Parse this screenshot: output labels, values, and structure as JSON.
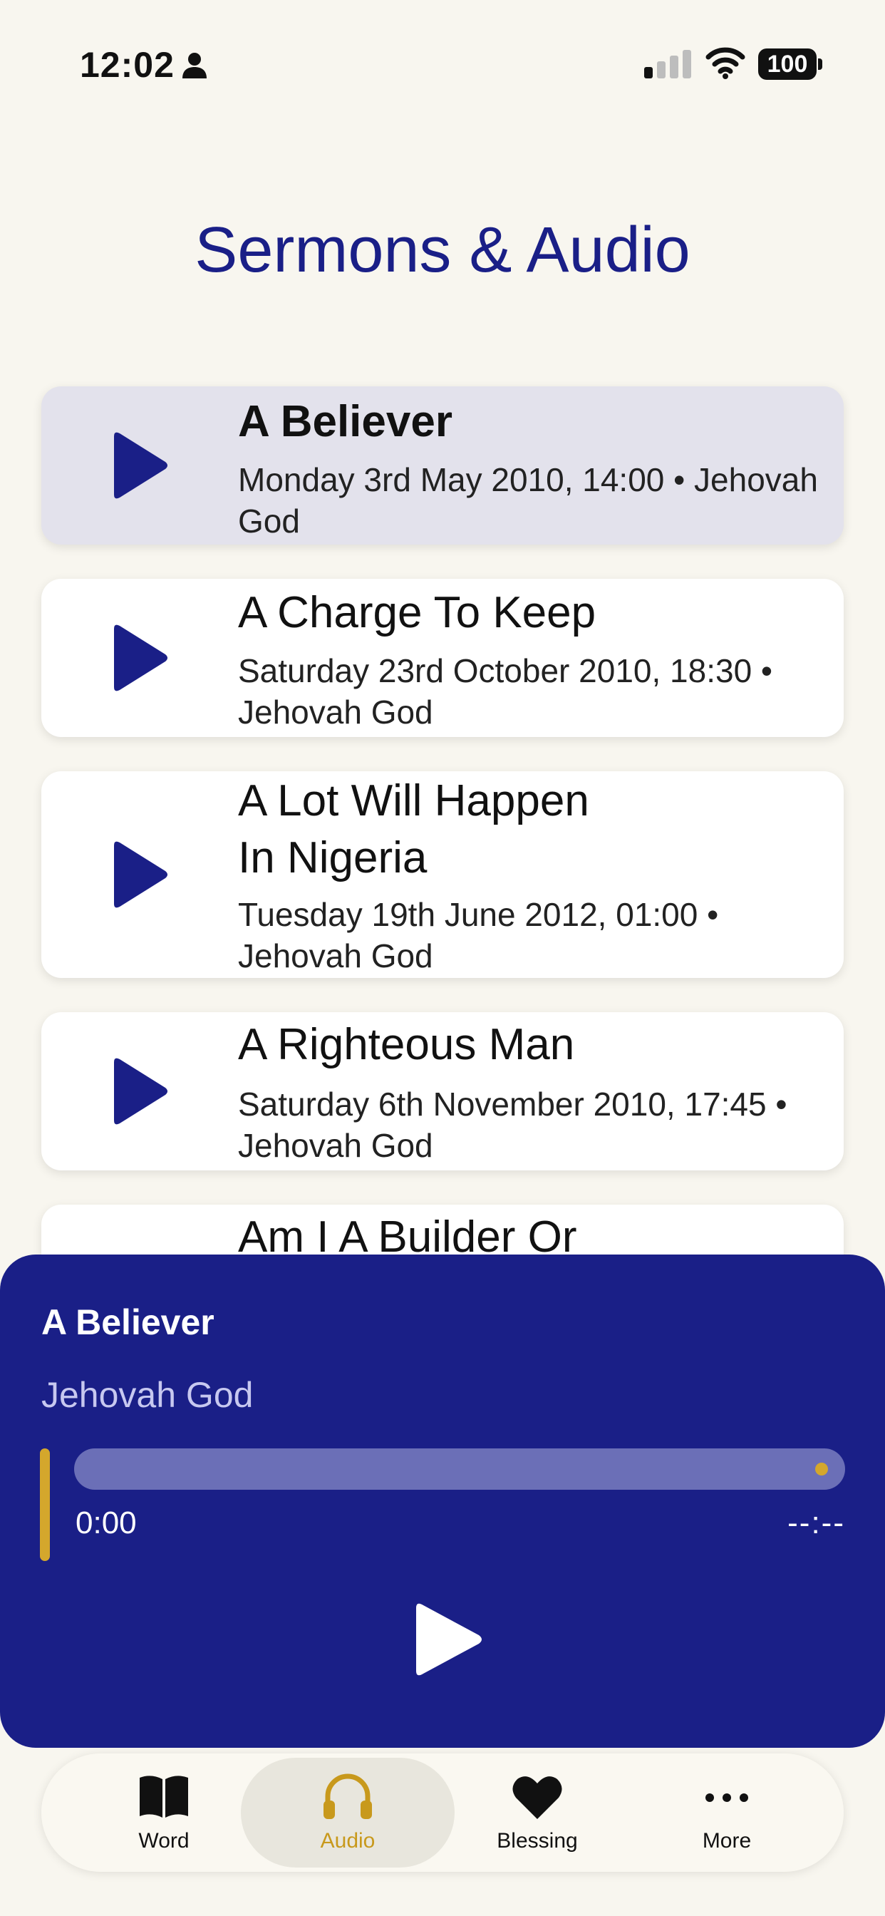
{
  "status": {
    "time": "12:02",
    "battery": "100"
  },
  "page": {
    "title": "Sermons & Audio"
  },
  "sermons": [
    {
      "title": "A Believer",
      "meta": "Monday 3rd May 2010, 14:00 • Jehovah God"
    },
    {
      "title": "A Charge To Keep",
      "meta": "Saturday 23rd October 2010, 18:30 • Jehovah God"
    },
    {
      "title": "A Lot Will Happen In Nigeria",
      "meta": "Tuesday 19th June 2012, 01:00 • Jehovah God"
    },
    {
      "title": "A Righteous Man",
      "meta": "Saturday 6th November 2010, 17:45 • Jehovah God"
    },
    {
      "title": "Am I A Builder Or",
      "meta": ""
    }
  ],
  "player": {
    "title": "A Believer",
    "artist": "Jehovah God",
    "current_time": "0:00",
    "total_time": "--:--",
    "progress": 0
  },
  "tabs": [
    {
      "label": "Word",
      "icon": "book-icon"
    },
    {
      "label": "Audio",
      "icon": "headphones-icon"
    },
    {
      "label": "Blessing",
      "icon": "heart-icon"
    },
    {
      "label": "More",
      "icon": "more-icon"
    }
  ],
  "colors": {
    "brand": "#1a1f87",
    "accent": "#d4a72c",
    "background": "#f8f6ef"
  }
}
